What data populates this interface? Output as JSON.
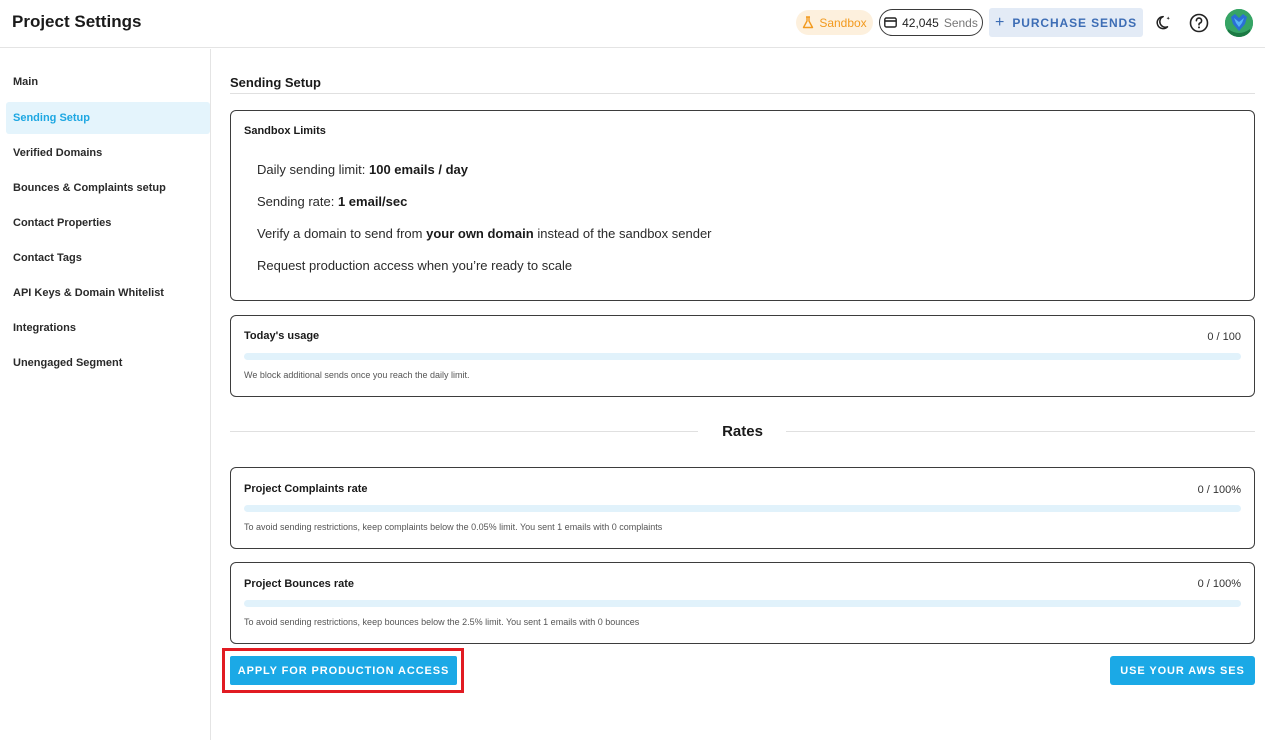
{
  "header": {
    "title": "Project Settings",
    "sandbox_label": "Sandbox",
    "sends_count": "42,045",
    "sends_label": "Sends",
    "purchase_label": "PURCHASE SENDS",
    "icons": [
      "flask-icon",
      "credit-card-icon",
      "plus-icon",
      "moon-icon",
      "help-icon",
      "avatar"
    ]
  },
  "sidebar": {
    "items": [
      {
        "label": "Main",
        "active": false
      },
      {
        "label": "Sending Setup",
        "active": true
      },
      {
        "label": "Verified Domains",
        "active": false
      },
      {
        "label": "Bounces & Complaints setup",
        "active": false
      },
      {
        "label": "Contact Properties",
        "active": false
      },
      {
        "label": "Contact Tags",
        "active": false
      },
      {
        "label": "API Keys & Domain Whitelist",
        "active": false
      },
      {
        "label": "Integrations",
        "active": false
      },
      {
        "label": "Unengaged Segment",
        "active": false
      }
    ]
  },
  "main": {
    "section_title": "Sending Setup",
    "sandbox_limits": {
      "title": "Sandbox Limits",
      "daily_prefix": "Daily sending limit: ",
      "daily_value": "100 emails / day",
      "rate_prefix": "Sending rate: ",
      "rate_value": "1 email/sec",
      "verify_prefix": "Verify a domain to send from ",
      "verify_bold": "your own domain",
      "verify_suffix": " instead of the sandbox sender",
      "request_text": "Request production access when you’re ready to scale"
    },
    "usage": {
      "title": "Today's usage",
      "ratio": "0 / 100",
      "progress": 0,
      "note": "We block additional sends once you reach the daily limit."
    },
    "rates_title": "Rates",
    "complaints": {
      "title": "Project Complaints rate",
      "ratio": "0 / 100%",
      "progress": 0,
      "note": "To avoid sending restrictions, keep complaints below the 0.05% limit. You sent 1 emails with 0 complaints"
    },
    "bounces": {
      "title": "Project Bounces rate",
      "ratio": "0 / 100%",
      "progress": 0,
      "note": "To avoid sending restrictions, keep bounces below the 2.5% limit. You sent 1 emails with 0 bounces"
    },
    "apply_label": "APPLY FOR PRODUCTION ACCESS",
    "aws_label": "USE YOUR AWS SES"
  },
  "colors": {
    "accent": "#1ba9e6",
    "sandbox_orange": "#f29a1f",
    "highlight_red": "#e11b22",
    "track": "#e1f2fb"
  }
}
